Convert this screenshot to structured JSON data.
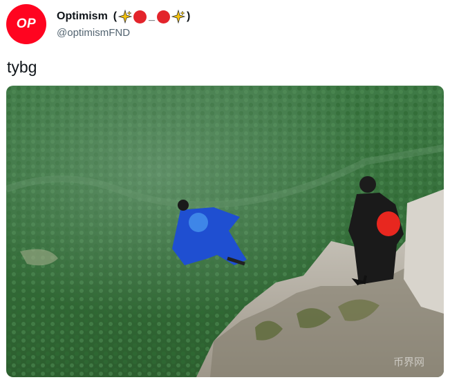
{
  "tweet": {
    "avatar_text": "OP",
    "display_name": "Optimism",
    "name_decor_open": "(",
    "name_decor_mid": "_",
    "name_decor_close": ")",
    "handle": "@optimismFND",
    "text": "tybg",
    "media": {
      "watermark": "币界网"
    }
  },
  "colors": {
    "brand_red": "#ff0420",
    "handle_gray": "#536471",
    "text_dark": "#0f1419"
  }
}
